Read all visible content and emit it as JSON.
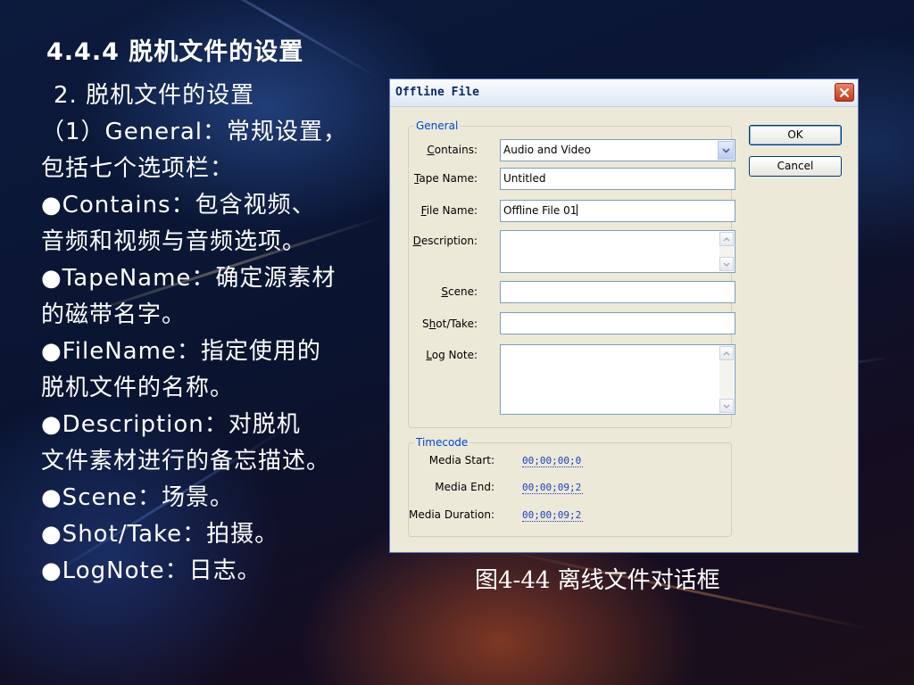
{
  "slide": {
    "title": "4.4.4 脱机文件的设置",
    "lines": [
      "2. 脱机文件的设置",
      "（1）General：常规设置，",
      "包括七个选项栏：",
      "●Contains：包含视频、",
      "音频和视频与音频选项。",
      "●TapeName：确定源素材",
      "的磁带名字。",
      "●FileName：指定使用的",
      "脱机文件的名称。",
      "●Description：对脱机",
      "文件素材进行的备忘描述。",
      "●Scene：场景。",
      "●Shot/Take：拍摄。",
      "●LogNote：日志。"
    ],
    "caption": "图4-44 离线文件对话框"
  },
  "dialog": {
    "title": "Offline File",
    "close_icon": "close-icon",
    "ok_label": "OK",
    "cancel_label": "Cancel",
    "general": {
      "legend": "General",
      "contains": {
        "label_hot": "C",
        "label_rest": "ontains:",
        "value": "Audio and Video"
      },
      "tape_name": {
        "label_hot": "T",
        "label_rest": "ape Name:",
        "value": "Untitled"
      },
      "file_name": {
        "label_hot": "F",
        "label_rest": "ile Name:",
        "value": "Offline File 01"
      },
      "description": {
        "label_hot": "D",
        "label_rest": "escription:",
        "value": ""
      },
      "scene": {
        "label_pre": "",
        "label_hot": "S",
        "label_rest": "cene:",
        "value": ""
      },
      "shot_take": {
        "label_pre": "S",
        "label_hot": "h",
        "label_rest": "ot/Take:",
        "value": ""
      },
      "log_note": {
        "label_hot": "L",
        "label_rest": "og Note:",
        "value": ""
      }
    },
    "timecode": {
      "legend": "Timecode",
      "media_start": {
        "label": "Media Start:",
        "value": "00;00;00;0"
      },
      "media_end": {
        "label": "Media End:",
        "value": "00;00;09;2"
      },
      "media_duration": {
        "label": "Media Duration:",
        "value": "00;00;09;2"
      }
    }
  }
}
